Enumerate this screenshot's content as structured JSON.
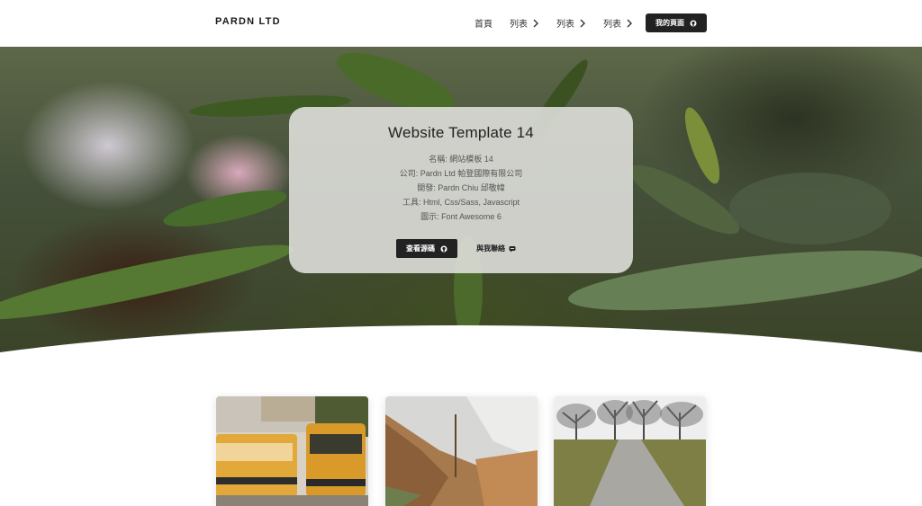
{
  "header": {
    "brand": "PARDN LTD",
    "nav": [
      {
        "label": "首頁",
        "has_chevron": false
      },
      {
        "label": "列表",
        "has_chevron": true
      },
      {
        "label": "列表",
        "has_chevron": true
      },
      {
        "label": "列表",
        "has_chevron": true
      }
    ],
    "cta_label": "我的頁面",
    "cta_icon": "github-icon"
  },
  "hero": {
    "title": "Website Template 14",
    "info": [
      "名稱: 網站模板 14",
      "公司: Pardn Ltd 帕登國際有限公司",
      "開發: Pardn Chiu 邱敬幃",
      "工具: Html, Css/Sass, Javascript",
      "圖示: Font Awesome 6"
    ],
    "source_button": {
      "label": "查看源碼",
      "icon": "github-icon"
    },
    "contact_button": {
      "label": "與我聯絡",
      "icon": "message-icon"
    }
  },
  "gallery": [
    {
      "subject": "yellow trams on city street"
    },
    {
      "subject": "autumn forest in misty mountains"
    },
    {
      "subject": "path between bare trees on grass"
    }
  ],
  "colors": {
    "accent_dark": "#222222",
    "card_bg": "#e1e1de",
    "page_bg": "#ffffff"
  }
}
